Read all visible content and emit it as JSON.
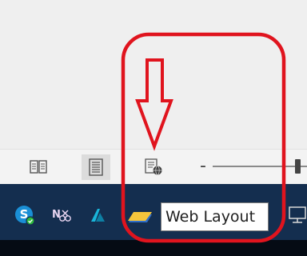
{
  "status_bar": {
    "views": [
      {
        "icon": "read-mode-icon",
        "active": false
      },
      {
        "icon": "print-layout-icon",
        "active": true
      },
      {
        "icon": "web-layout-icon",
        "active": false
      }
    ],
    "zoom_out_label": "-",
    "zoom_level": 0.9
  },
  "tooltip": {
    "text": "Web Layout"
  },
  "taskbar": {
    "icons": [
      "skype-icon",
      "onenote-icon",
      "autodesk-icon",
      "folder-icon",
      "network-icon"
    ]
  },
  "annotation": {
    "color": "#e0141e"
  }
}
